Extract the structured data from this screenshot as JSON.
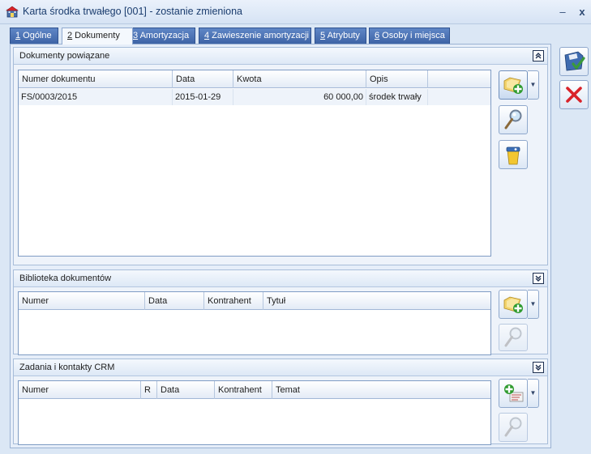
{
  "window": {
    "title": "Karta środka trwałego [001] - zostanie zmieniona",
    "minimize_label": "–",
    "close_label": "x"
  },
  "tabs": [
    {
      "key": "1",
      "label": " Ogólne"
    },
    {
      "key": "2",
      "label": " Dokumenty"
    },
    {
      "key": "3",
      "label": " Amortyzacja"
    },
    {
      "key": "4",
      "label": " Zawieszenie amortyzacji"
    },
    {
      "key": "5",
      "label": " Atrybuty"
    },
    {
      "key": "6",
      "label": " Osoby i miejsca"
    }
  ],
  "active_tab": 1,
  "sections": {
    "related_docs": {
      "title": "Dokumenty powiązane",
      "collapse_icon": "double-chevron-up-icon",
      "columns": [
        "Numer dokumentu",
        "Data",
        "Kwota",
        "Opis"
      ],
      "rows": [
        {
          "number": "FS/0003/2015",
          "date": "2015-01-29",
          "amount": "60 000,00",
          "desc": "środek trwały"
        }
      ]
    },
    "library": {
      "title": "Biblioteka dokumentów",
      "collapse_icon": "double-chevron-down-icon",
      "columns": [
        "Numer",
        "Data",
        "Kontrahent",
        "Tytuł"
      ],
      "rows": []
    },
    "crm": {
      "title": "Zadania i kontakty CRM",
      "collapse_icon": "double-chevron-down-icon",
      "columns": [
        "Numer",
        "R",
        "Data",
        "Kontrahent",
        "Temat"
      ],
      "rows": []
    }
  },
  "colors": {
    "tab_blue": "#4a72b5",
    "window_bg": "#dbe7f5",
    "close_red": "#d9232a",
    "save_green": "#3a9a3a"
  }
}
